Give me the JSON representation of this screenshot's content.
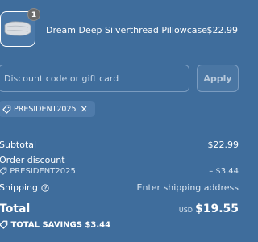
{
  "product": {
    "quantity": "1",
    "name": "Dream Deep Silverthread Pillowcase",
    "price": "$22.99"
  },
  "discount": {
    "placeholder": "Discount code or gift card",
    "apply_label": "Apply",
    "applied_code": "PRESIDENT2025"
  },
  "summary": {
    "subtotal_label": "Subtotal",
    "subtotal_value": "$22.99",
    "order_discount_label": "Order discount",
    "discount_code": "PRESIDENT2025",
    "discount_value": "– $3.44",
    "shipping_label": "Shipping",
    "shipping_value": "Enter shipping address",
    "total_label": "Total",
    "currency": "USD",
    "total_value": "$19.55",
    "savings_label": "TOTAL SAVINGS $3.44"
  },
  "icons": {
    "tag": "tag-icon",
    "close": "close-icon",
    "help": "help-circle-icon"
  },
  "colors": {
    "background": "#3f6d9c",
    "text": "#ffffff"
  }
}
